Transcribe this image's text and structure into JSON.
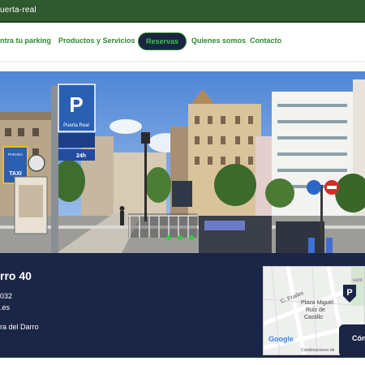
{
  "topbar": {
    "url_text": "uerta-real"
  },
  "nav": {
    "items": [
      {
        "label": "ntra tu parking"
      },
      {
        "label": "Productos y Servicios"
      },
      {
        "label": "Reservas"
      },
      {
        "label": "Quienes somos"
      },
      {
        "label": "Contacto"
      }
    ]
  },
  "hero": {
    "sign_letter": "P",
    "sign_name": "Puerta Real",
    "sign_badge": "24h",
    "taxi_label": "TAXI",
    "taxi_top": "PARADA"
  },
  "info": {
    "title": "rro 40",
    "phone": "032",
    "web": ".es",
    "address": "ra del Darro"
  },
  "map": {
    "street_1": "C. Frailes",
    "place_1": "Plaza Miguel",
    "place_2": "Ruiz de",
    "place_3": "Castillo",
    "label_right": "uent",
    "logo": "Google",
    "footer": "Combinaciones de"
  },
  "contact": {
    "label": "Cón"
  },
  "colors": {
    "brand_green": "#2e8b2e",
    "nav_active_bg": "#1b2442",
    "panel_bg": "#1b2545",
    "topbar": "#2f5a2f"
  }
}
